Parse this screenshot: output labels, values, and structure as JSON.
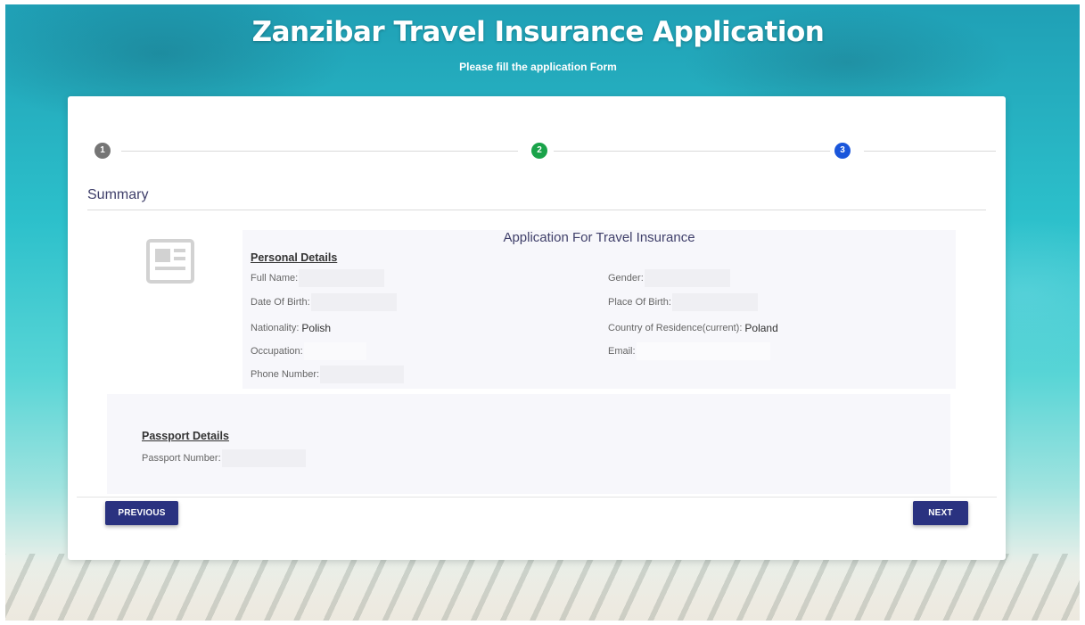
{
  "header": {
    "title": "Zanzibar Travel Insurance Application",
    "subtitle": "Please fill the application Form"
  },
  "stepper": {
    "steps": [
      {
        "label": "1",
        "state": "completed",
        "color": "#757575"
      },
      {
        "label": "2",
        "state": "completed",
        "color": "#1aa34a"
      },
      {
        "label": "3",
        "state": "active",
        "color": "#1a56db"
      }
    ]
  },
  "summary": {
    "title": "Summary",
    "application_title": "Application For Travel Insurance",
    "icon": "document-icon",
    "personal": {
      "heading": "Personal Details",
      "full_name_label": "Full Name:",
      "full_name_value": "",
      "gender_label": "Gender:",
      "gender_value": "",
      "dob_label": "Date Of Birth:",
      "dob_value": "",
      "pob_label": "Place Of Birth:",
      "pob_value": "",
      "nationality_label": "Nationality:",
      "nationality_value": "Polish",
      "residence_label": "Country of Residence(current):",
      "residence_value": "Poland",
      "occupation_label": "Occupation:",
      "occupation_value": "",
      "email_label": "Email:",
      "email_value": "",
      "phone_label": "Phone Number:",
      "phone_value": ""
    },
    "passport": {
      "heading": "Passport Details",
      "number_label": "Passport Number:",
      "number_value": ""
    }
  },
  "buttons": {
    "previous": "PREVIOUS",
    "next": "NEXT"
  },
  "colors": {
    "button_bg": "#2a3280",
    "heading_text": "#3f3f6a",
    "panel_bg": "#f7f7fb"
  }
}
